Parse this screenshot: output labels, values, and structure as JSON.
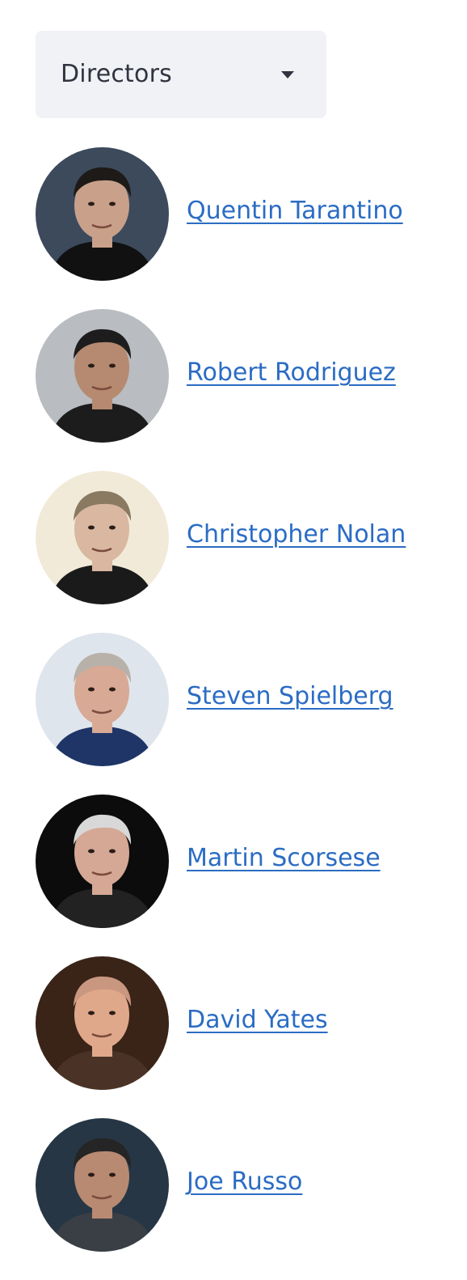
{
  "select": {
    "value": "Directors",
    "icon": "chevron-down-icon"
  },
  "directors": [
    {
      "name": "Quentin Tarantino",
      "bg": "#3c4a5c",
      "skin": "#c9a08a",
      "hair": "#1e1a18",
      "top": "#111111"
    },
    {
      "name": "Robert Rodriguez",
      "bg": "#b9bcc0",
      "skin": "#b58a70",
      "hair": "#1d1d1d",
      "top": "#1c1c1c"
    },
    {
      "name": "Christopher Nolan",
      "bg": "#f1ead8",
      "skin": "#d9b7a0",
      "hair": "#8a7a62",
      "top": "#1a1a1a"
    },
    {
      "name": "Steven Spielberg",
      "bg": "#dfe5ec",
      "skin": "#d8a994",
      "hair": "#b8b1a9",
      "top": "#1f3568"
    },
    {
      "name": "Martin Scorsese",
      "bg": "#0c0c0c",
      "skin": "#d4a894",
      "hair": "#d8d8d8",
      "top": "#222222"
    },
    {
      "name": "David Yates",
      "bg": "#3a2418",
      "skin": "#e0a88a",
      "hair": "#c99780",
      "top": "#4a3326"
    },
    {
      "name": "Joe Russo",
      "bg": "#263645",
      "skin": "#b88a72",
      "hair": "#252525",
      "top": "#3a3f46"
    }
  ]
}
